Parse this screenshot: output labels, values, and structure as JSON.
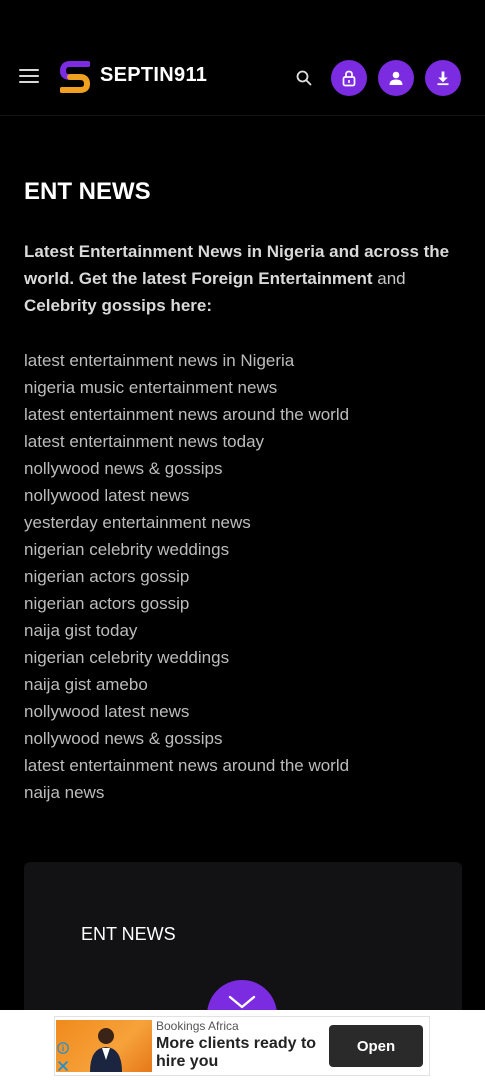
{
  "header": {
    "brand": "SEPTIN911",
    "icons": [
      "hamburger-menu-icon",
      "logo-s-icon",
      "search-icon",
      "lock-icon",
      "user-icon",
      "download-icon"
    ],
    "accent_color": "#7b2be0"
  },
  "main": {
    "title": "ENT NEWS",
    "intro": {
      "bold_part": "Latest Entertainment News in Nigeria and across the world. Get the latest Foreign Entertainment",
      "normal_part": " and ",
      "bold_part_2": "Celebrity gossips here:"
    },
    "keywords": [
      "latest entertainment news in Nigeria",
      "nigeria music entertainment news",
      "latest entertainment news around the world",
      "latest entertainment news today",
      "nollywood news & gossips",
      "nollywood latest news",
      "yesterday entertainment news",
      "nigerian celebrity weddings",
      "nigerian actors gossip",
      "nigerian actors gossip",
      "naija gist today",
      "nigerian celebrity weddings",
      "naija gist amebo",
      "nollywood latest news",
      "nollywood news & gossips",
      "latest entertainment news around the world",
      "naija news"
    ]
  },
  "card": {
    "title": "ENT NEWS"
  },
  "ad": {
    "sponsor": "Bookings Africa",
    "headline": "More clients ready to hire you",
    "cta": "Open"
  }
}
